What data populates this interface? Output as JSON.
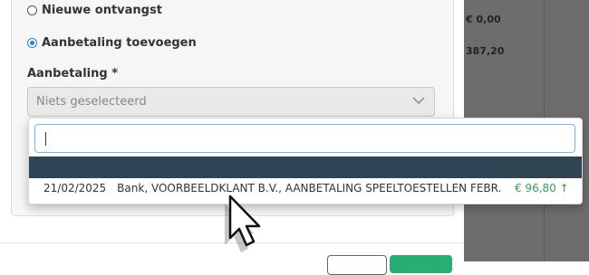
{
  "form": {
    "radio_new_receipt": "Nieuwe ontvangst",
    "radio_add_payment": "Aanbetaling toevoegen",
    "payment_label": "Aanbetaling *",
    "payment_select_placeholder": "Niets geselecteerd"
  },
  "right_panel": {
    "value1": "€ 0,00",
    "value2": "387,20"
  },
  "dropdown": {
    "search_value": "",
    "options": [
      {
        "date": "21/02/2025",
        "description": "Bank, VOORBEELDKLANT B.V., AANBETALING SPEELTOESTELLEN FEBR.",
        "amount": "€ 96,80 ↑"
      }
    ]
  },
  "colors": {
    "accent_blue": "#1e88e5",
    "highlight_row": "#2f4554",
    "amount_green": "#2e9e5b",
    "primary_button": "#27ae73"
  },
  "icons": [
    "radio-unchecked-icon",
    "radio-checked-icon",
    "chevron-down-icon",
    "mouse-pointer-icon"
  ]
}
